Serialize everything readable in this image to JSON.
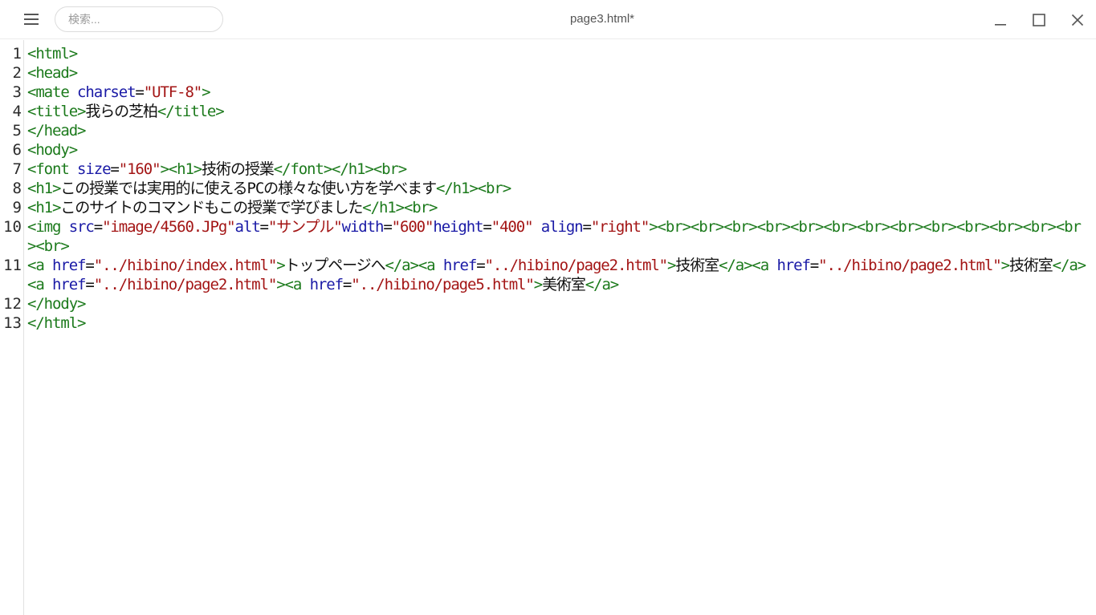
{
  "window": {
    "title": "page3.html*",
    "search_placeholder": "検索..."
  },
  "icons": {
    "menu": "hamburger-menu-icon",
    "minimize": "minimize-icon",
    "maximize": "maximize-icon",
    "close": "close-icon"
  },
  "colors": {
    "tag": "#1c7a1c",
    "attribute": "#1a1aa6",
    "value": "#a31515",
    "text": "#111111"
  },
  "editor": {
    "lines": [
      {
        "n": "1",
        "tokens": [
          [
            "tag",
            "<html>"
          ]
        ]
      },
      {
        "n": "2",
        "tokens": [
          [
            "tag",
            "<head>"
          ]
        ]
      },
      {
        "n": "3",
        "tokens": [
          [
            "tag",
            "<mate "
          ],
          [
            "attr",
            "charset"
          ],
          [
            "txt",
            "="
          ],
          [
            "val",
            "\"UTF-8\""
          ],
          [
            "tag",
            ">"
          ]
        ]
      },
      {
        "n": "4",
        "tokens": [
          [
            "tag",
            "<title>"
          ],
          [
            "txt",
            "我らの芝柏"
          ],
          [
            "tag",
            "</title>"
          ]
        ]
      },
      {
        "n": "5",
        "tokens": [
          [
            "tag",
            "</head>"
          ]
        ]
      },
      {
        "n": "6",
        "tokens": [
          [
            "tag",
            "<hody>"
          ]
        ]
      },
      {
        "n": "7",
        "tokens": [
          [
            "tag",
            "<font "
          ],
          [
            "attr",
            "size"
          ],
          [
            "txt",
            "="
          ],
          [
            "val",
            "\"160\""
          ],
          [
            "tag",
            "><h1>"
          ],
          [
            "txt",
            "技術の授業"
          ],
          [
            "tag",
            "</font></h1><br>"
          ]
        ]
      },
      {
        "n": "8",
        "tokens": [
          [
            "tag",
            "<h1>"
          ],
          [
            "txt",
            "この授業では実用的に使えるPCの様々な使い方を学べます"
          ],
          [
            "tag",
            "</h1><br>"
          ]
        ]
      },
      {
        "n": "9",
        "tokens": [
          [
            "tag",
            "<h1>"
          ],
          [
            "txt",
            "このサイトのコマンドもこの授業で学びました"
          ],
          [
            "tag",
            "</h1><br>"
          ]
        ]
      },
      {
        "n": "10",
        "tokens": [
          [
            "tag",
            "<img "
          ],
          [
            "attr",
            "src"
          ],
          [
            "txt",
            "="
          ],
          [
            "val",
            "\"image/4560.JPg\""
          ],
          [
            "attr",
            "alt"
          ],
          [
            "txt",
            "="
          ],
          [
            "val",
            "\"サンプル\""
          ],
          [
            "attr",
            "width"
          ],
          [
            "txt",
            "="
          ],
          [
            "val",
            "\"600\""
          ],
          [
            "attr",
            "height"
          ],
          [
            "txt",
            "="
          ],
          [
            "val",
            "\"400\" "
          ],
          [
            "attr",
            "align"
          ],
          [
            "txt",
            "="
          ],
          [
            "val",
            "\"right\""
          ],
          [
            "tag",
            "><br><br><br><br><br><br><br><br><br><br><br><br><br><br>"
          ]
        ]
      },
      {
        "n": "11",
        "tokens": [
          [
            "tag",
            "<a "
          ],
          [
            "attr",
            "href"
          ],
          [
            "txt",
            "="
          ],
          [
            "val",
            "\"../hibino/index.html\""
          ],
          [
            "tag",
            ">"
          ],
          [
            "txt",
            "トップページへ"
          ],
          [
            "tag",
            "</a><a "
          ],
          [
            "attr",
            "href"
          ],
          [
            "txt",
            "="
          ],
          [
            "val",
            "\"../hibino/page2.html\""
          ],
          [
            "tag",
            ">"
          ],
          [
            "txt",
            "技術室"
          ],
          [
            "tag",
            "</a><a "
          ],
          [
            "attr",
            "href"
          ],
          [
            "txt",
            "="
          ],
          [
            "val",
            "\"../hibino/page2.html\""
          ],
          [
            "tag",
            ">"
          ],
          [
            "txt",
            "技術室"
          ],
          [
            "tag",
            "</a><a "
          ],
          [
            "attr",
            "href"
          ],
          [
            "txt",
            "="
          ],
          [
            "val",
            "\"../hibino/page2.html\""
          ],
          [
            "tag",
            "><a "
          ],
          [
            "attr",
            "href"
          ],
          [
            "txt",
            "="
          ],
          [
            "val",
            "\"../hibino/page5.html\""
          ],
          [
            "tag",
            ">"
          ],
          [
            "txt",
            "美術室"
          ],
          [
            "tag",
            "</a>"
          ]
        ]
      },
      {
        "n": "12",
        "tokens": [
          [
            "tag",
            "</hody>"
          ]
        ]
      },
      {
        "n": "13",
        "tokens": [
          [
            "tag",
            "</html>"
          ]
        ]
      }
    ]
  }
}
